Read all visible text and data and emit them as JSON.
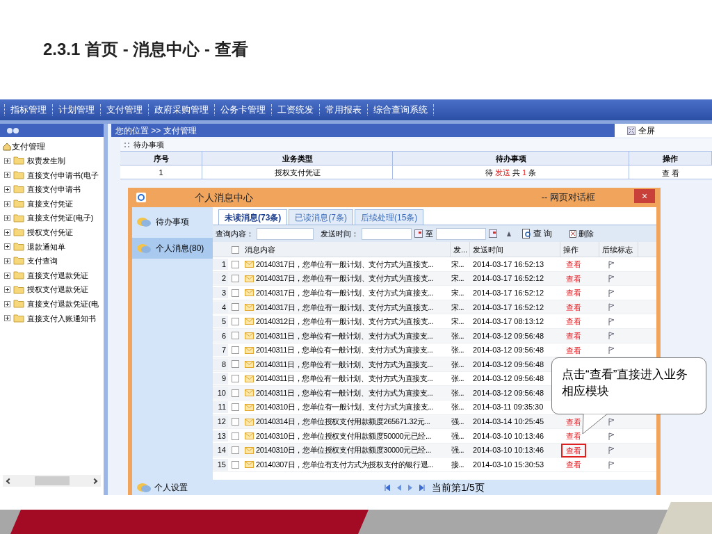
{
  "slide_title": "2.3.1 首页 - 消息中心 - 查看",
  "nav": {
    "items": [
      "指标管理",
      "计划管理",
      "支付管理",
      "政府采购管理",
      "公务卡管理",
      "工资统发",
      "常用报表",
      "综合查询系统"
    ]
  },
  "breadcrumb": {
    "label": "您的位置",
    "separator": ">>",
    "current": "支付管理"
  },
  "fullscreen": "全屏",
  "sidebar": {
    "root": "支付管理",
    "items": [
      {
        "label": "权责发生制",
        "expanded": false
      },
      {
        "label": "直接支付申请书(电子",
        "expanded": false
      },
      {
        "label": "直接支付申请书",
        "expanded": false
      },
      {
        "label": "直接支付凭证",
        "expanded": false
      },
      {
        "label": "直接支付凭证(电子)",
        "expanded": false
      },
      {
        "label": "授权支付凭证",
        "expanded": false
      },
      {
        "label": "退款通知单",
        "expanded": false
      },
      {
        "label": "支付查询",
        "expanded": false
      },
      {
        "label": "直接支付退款凭证",
        "expanded": false
      },
      {
        "label": "授权支付退款凭证",
        "expanded": false
      },
      {
        "label": "直接支付退款凭证(电",
        "expanded": false
      },
      {
        "label": "直接支付入账通知书",
        "expanded": false
      }
    ]
  },
  "todo": {
    "title": "待办事项",
    "columns": [
      "序号",
      "业务类型",
      "待办事项",
      "操作"
    ],
    "rows": [
      {
        "no": "1",
        "type": "授权支付凭证",
        "pre": "待",
        "verb": "发送",
        "mid": "共",
        "count": "1",
        "post": "条",
        "action": "查 看"
      }
    ]
  },
  "dialog": {
    "title": "个人消息中心",
    "subtitle": "-- 网页对话框",
    "close": "×",
    "side_items": [
      {
        "label": "待办事项",
        "selected": false
      },
      {
        "label": "个人消息(80)",
        "selected": true
      }
    ],
    "settings": "个人设置",
    "tabs": [
      {
        "label": "未读消息(73条)",
        "selected": true
      },
      {
        "label": "已读消息(7条)",
        "selected": false
      },
      {
        "label": "后续处理(15条)",
        "selected": false
      }
    ],
    "all_checked": false,
    "search_label": "查询内容：",
    "time_label": "发送时间：",
    "to": "至",
    "query_button": "查 询",
    "delete_button": "删除",
    "columns": [
      "消息内容",
      "发...",
      "发送时间",
      "操作",
      "后续标志"
    ],
    "rows": [
      {
        "no": "1",
        "checked": false,
        "content": "20140317日，您单位有一般计划、支付方式为直接支...",
        "sender": "宋...",
        "time": "2014-03-17 16:52:13",
        "action": "查看"
      },
      {
        "no": "2",
        "checked": false,
        "content": "20140317日，您单位有一般计划、支付方式为直接支...",
        "sender": "宋...",
        "time": "2014-03-17 16:52:12",
        "action": "查看"
      },
      {
        "no": "3",
        "checked": false,
        "content": "20140317日，您单位有一般计划、支付方式为直接支...",
        "sender": "宋...",
        "time": "2014-03-17 16:52:12",
        "action": "查看"
      },
      {
        "no": "4",
        "checked": false,
        "content": "20140317日，您单位有一般计划、支付方式为直接支...",
        "sender": "宋...",
        "time": "2014-03-17 16:52:12",
        "action": "查看"
      },
      {
        "no": "5",
        "checked": false,
        "content": "20140312日，您单位有一般计划、支付方式为直接支...",
        "sender": "宋...",
        "time": "2014-03-17 08:13:12",
        "action": "查看"
      },
      {
        "no": "6",
        "checked": false,
        "content": "20140311日，您单位有一般计划、支付方式为直接支...",
        "sender": "张...",
        "time": "2014-03-12 09:56:48",
        "action": "查看"
      },
      {
        "no": "7",
        "checked": false,
        "content": "20140311日，您单位有一般计划、支付方式为直接支...",
        "sender": "张...",
        "time": "2014-03-12 09:56:48",
        "action": "查看"
      },
      {
        "no": "8",
        "checked": false,
        "content": "20140311日，您单位有一般计划、支付方式为直接支...",
        "sender": "张...",
        "time": "2014-03-12 09:56:48"
      },
      {
        "no": "9",
        "checked": false,
        "content": "20140311日，您单位有一般计划、支付方式为直接支...",
        "sender": "张...",
        "time": "2014-03-12 09:56:48"
      },
      {
        "no": "10",
        "checked": false,
        "content": "20140311日，您单位有一般计划、支付方式为直接支...",
        "sender": "张...",
        "time": "2014-03-12 09:56:48"
      },
      {
        "no": "11",
        "checked": false,
        "content": "20140310日，您单位有一般计划、支付方式为直接支...",
        "sender": "张...",
        "time": "2014-03-11 09:35:30"
      },
      {
        "no": "12",
        "checked": false,
        "content": "20140314日，您单位授权支付用款额度265671.32元...",
        "sender": "强...",
        "time": "2014-03-14 10:25:45",
        "action": "查看"
      },
      {
        "no": "13",
        "checked": false,
        "content": "20140310日，您单位授权支付用款额度50000元已经...",
        "sender": "强...",
        "time": "2014-03-10 10:13:46",
        "action": "查看"
      },
      {
        "no": "14",
        "checked": false,
        "content": "20140310日，您单位授权支付用款额度30000元已经...",
        "sender": "强...",
        "time": "2014-03-10 10:13:46",
        "action": "查看",
        "highlighted": true
      },
      {
        "no": "15",
        "checked": false,
        "content": "20140307日，您单位有支付方式为授权支付的银行退...",
        "sender": "接...",
        "time": "2014-03-10 15:30:53",
        "action": "查看"
      }
    ],
    "pager": "当前第1/5页"
  },
  "callout": "点击“查看”直接进入业务相应模块"
}
